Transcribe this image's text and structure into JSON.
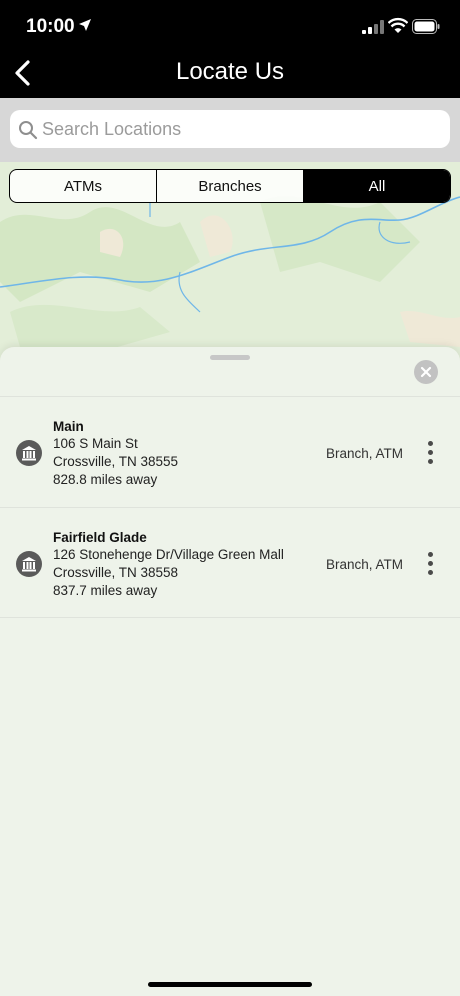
{
  "status_bar": {
    "time": "10:00"
  },
  "header": {
    "title": "Locate Us"
  },
  "search": {
    "placeholder": "Search Locations",
    "value": ""
  },
  "segments": {
    "items": [
      "ATMs",
      "Branches",
      "All"
    ],
    "selected": "All"
  },
  "locations": [
    {
      "name": "Main",
      "address_line1": "106 S Main St",
      "address_line2": "Crossville, TN 38555",
      "distance": "828.8 miles away",
      "type": "Branch, ATM"
    },
    {
      "name": "Fairfield Glade",
      "address_line1": "126 Stonehenge Dr/Village Green Mall",
      "address_line2": "Crossville, TN 38558",
      "distance": "837.7 miles away",
      "type": "Branch, ATM"
    }
  ],
  "colors": {
    "header_bg": "#000000",
    "map_green": "#e3eed8",
    "river": "#6fb6e8"
  }
}
